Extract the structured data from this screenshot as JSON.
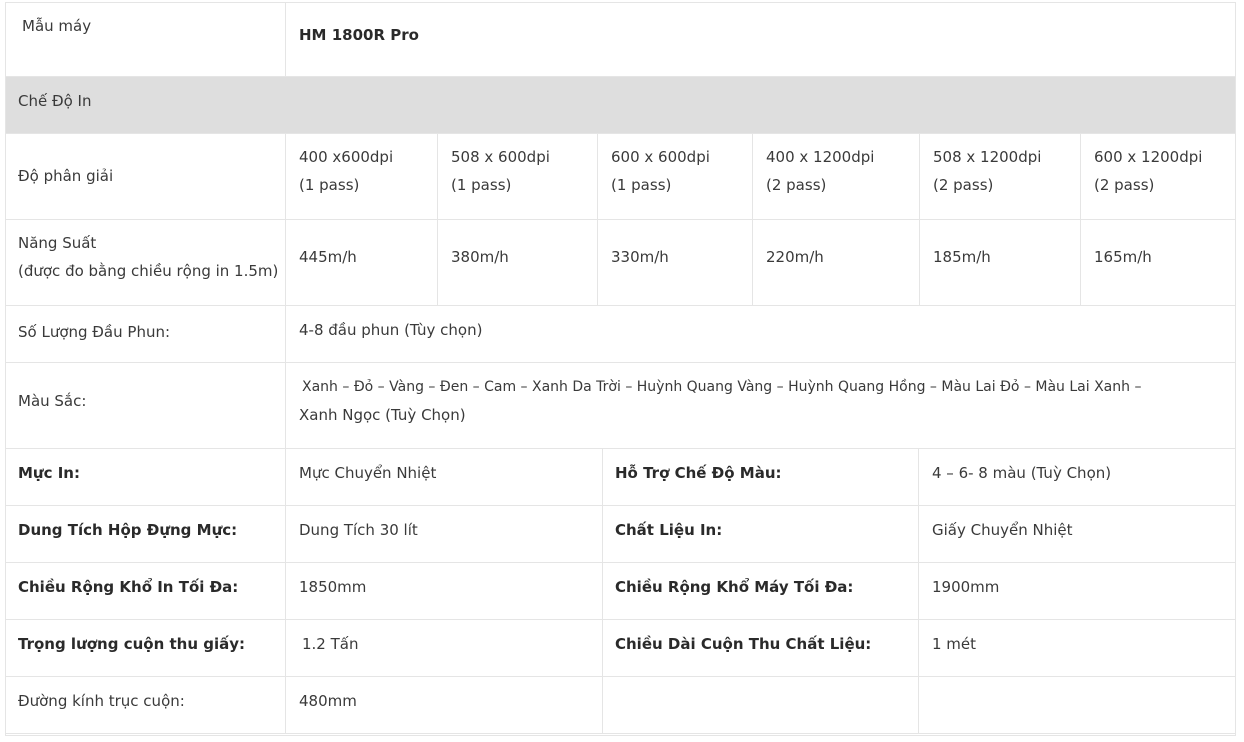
{
  "table": {
    "model": {
      "label": "Mẫu máy",
      "value": "HM 1800R Pro"
    },
    "print_mode_header": "Chế Độ In",
    "resolution": {
      "label": "Độ phân giải",
      "modes": [
        {
          "dpi": "400 x600dpi",
          "pass": "(1 pass)"
        },
        {
          "dpi": "508 x 600dpi",
          "pass": "(1 pass)"
        },
        {
          "dpi": "600 x 600dpi",
          "pass": "(1 pass)"
        },
        {
          "dpi": "400 x 1200dpi",
          "pass": "(2 pass)"
        },
        {
          "dpi": "508 x 1200dpi",
          "pass": "(2 pass)"
        },
        {
          "dpi": "600 x 1200dpi",
          "pass": "(2 pass)"
        }
      ]
    },
    "productivity": {
      "label_line1": "Năng Suất",
      "label_line2": "(được đo bằng chiều rộng in 1.5m)",
      "values": [
        "445m/h",
        "380m/h",
        "330m/h",
        "220m/h",
        "185m/h",
        "165m/h"
      ]
    },
    "heads": {
      "label": "Số Lượng Đầu Phun:",
      "value": "4-8 đầu phun (Tùy chọn)"
    },
    "colors": {
      "label": "Màu Sắc:",
      "line1": "Xanh – Đỏ – Vàng – Đen – Cam – Xanh Da Trời – Huỳnh Quang Vàng – Huỳnh Quang Hồng – Màu Lai Đỏ – Màu Lai Xanh –",
      "line2": "Xanh Ngọc (Tuỳ Chọn)"
    },
    "specs": [
      {
        "label1": "Mực In:",
        "value1": "Mực Chuyển Nhiệt",
        "label2": "Hỗ Trợ Chế Độ Màu:",
        "value2": "4 – 6- 8 màu (Tuỳ Chọn)"
      },
      {
        "label1": "Dung Tích Hộp Đựng Mực:",
        "value1": "Dung Tích 30 lít",
        "label2": "Chất Liệu In:",
        "value2": "Giấy Chuyển Nhiệt"
      },
      {
        "label1": "Chiều Rộng Khổ In Tối Đa:",
        "value1": "1850mm",
        "label2": "Chiều Rộng Khổ Máy Tối Đa:",
        "value2": "1900mm"
      },
      {
        "label1": "Trọng lượng cuộn thu giấy:",
        "value1": "1.2 Tấn",
        "label2": "Chiều Dài Cuộn Thu Chất Liệu:",
        "value2": "1 mét"
      }
    ],
    "roll_diameter": {
      "label": "Đường kính trục cuộn:",
      "value": "480mm"
    }
  }
}
